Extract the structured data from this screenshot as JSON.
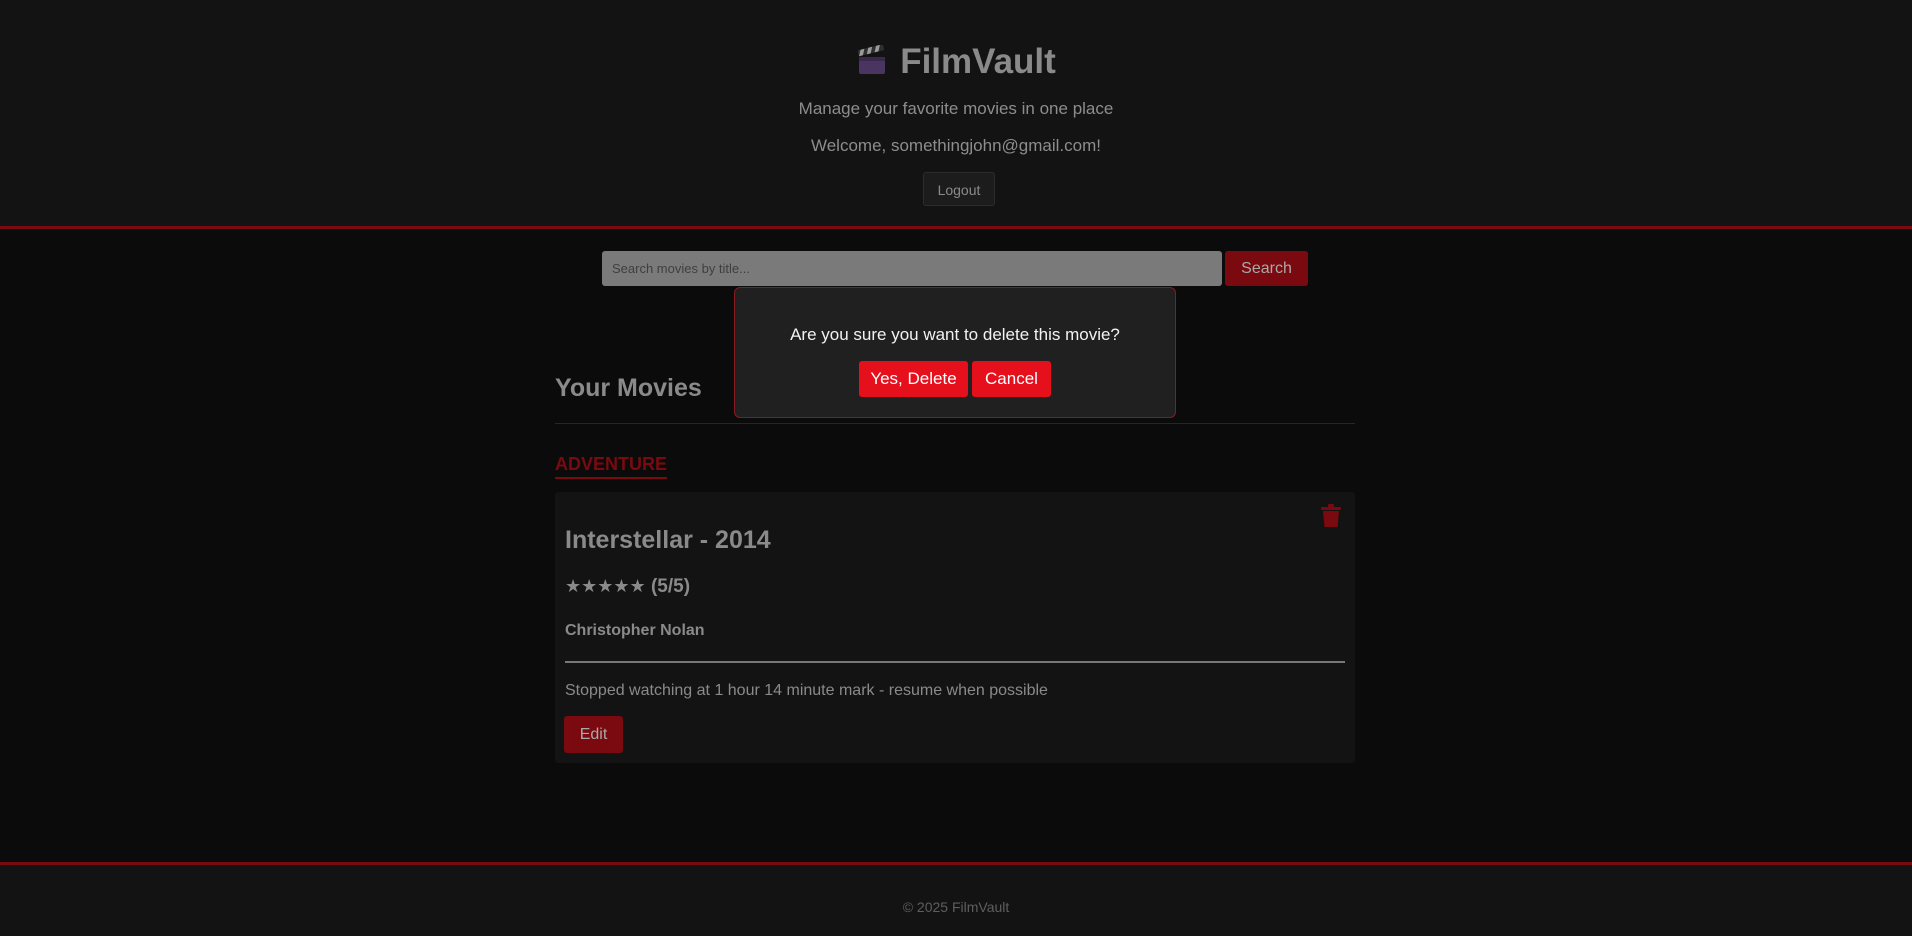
{
  "header": {
    "icon": "clapperboard-icon",
    "app_name": "FilmVault",
    "subtitle": "Manage your favorite movies in one place",
    "welcome": "Welcome, somethingjohn@gmail.com!",
    "logout_label": "Logout"
  },
  "search": {
    "placeholder": "Search movies by title...",
    "value": "",
    "button_label": "Search"
  },
  "main": {
    "section_title": "Your Movies",
    "genres": [
      {
        "name": "ADVENTURE",
        "movies": [
          {
            "title": "Interstellar - 2014",
            "stars": "★★★★★",
            "rating_text": "(5/5)",
            "rating_value": 5,
            "rating_max": 5,
            "director": "Christopher Nolan",
            "notes": "Stopped watching at 1 hour 14 minute mark - resume when possible",
            "edit_label": "Edit",
            "delete_icon": "trash-icon"
          }
        ]
      }
    ]
  },
  "modal": {
    "message": "Are you sure you want to delete this movie?",
    "confirm_label": "Yes, Delete",
    "cancel_label": "Cancel"
  },
  "footer": {
    "text": "© 2025 FilmVault"
  },
  "colors": {
    "accent_dark": "#7a0a10",
    "accent_bright": "#e5101c",
    "background": "#0b0b0b",
    "panel": "#131313"
  }
}
